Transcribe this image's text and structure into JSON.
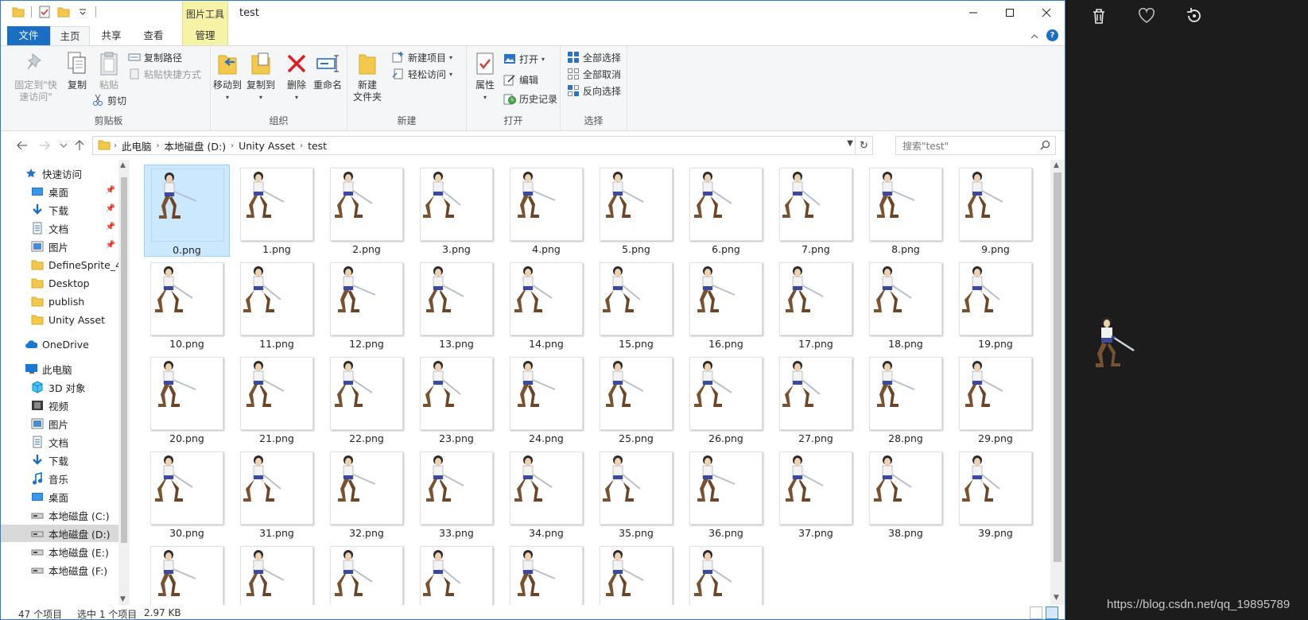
{
  "titlebar": {
    "contextual_tab": "图片工具",
    "title": "test"
  },
  "tabs": [
    {
      "label": "文件",
      "kind": "file"
    },
    {
      "label": "主页",
      "kind": "active"
    },
    {
      "label": "共享",
      "kind": "normal"
    },
    {
      "label": "查看",
      "kind": "normal"
    },
    {
      "label": "管理",
      "kind": "manage"
    }
  ],
  "ribbon": {
    "clipboard": {
      "label": "剪贴板",
      "pin_quick_access": "固定到\"快\n速访问\"",
      "copy": "复制",
      "paste": "粘贴",
      "copy_path": "复制路径",
      "paste_shortcut": "粘贴快捷方式",
      "cut": "剪切"
    },
    "organize": {
      "label": "组织",
      "move_to": "移动到",
      "copy_to": "复制到",
      "delete": "删除",
      "rename": "重命名"
    },
    "new": {
      "label": "新建",
      "new_folder": "新建\n文件夹",
      "new_item": "新建项目",
      "easy_access": "轻松访问"
    },
    "open": {
      "label": "打开",
      "properties": "属性",
      "open": "打开",
      "edit": "编辑",
      "history": "历史记录"
    },
    "select": {
      "label": "选择",
      "select_all": "全部选择",
      "select_none": "全部取消",
      "invert": "反向选择"
    }
  },
  "address": {
    "crumbs": [
      "此电脑",
      "本地磁盘 (D:)",
      "Unity Asset",
      "test"
    ],
    "search_placeholder": "搜索\"test\""
  },
  "nav": [
    {
      "label": "快速访问",
      "icon": "star-icon",
      "indent": 0
    },
    {
      "label": "桌面",
      "icon": "desktop-icon",
      "indent": 1,
      "pinned": true
    },
    {
      "label": "下载",
      "icon": "download-icon",
      "indent": 1,
      "pinned": true
    },
    {
      "label": "文档",
      "icon": "document-icon",
      "indent": 1,
      "pinned": true
    },
    {
      "label": "图片",
      "icon": "picture-icon",
      "indent": 1,
      "pinned": true
    },
    {
      "label": "DefineSprite_46",
      "icon": "folder-icon",
      "indent": 1
    },
    {
      "label": "Desktop",
      "icon": "folder-icon",
      "indent": 1
    },
    {
      "label": "publish",
      "icon": "folder-icon",
      "indent": 1
    },
    {
      "label": "Unity Asset",
      "icon": "folder-icon",
      "indent": 1
    },
    {
      "label": "OneDrive",
      "icon": "cloud-icon",
      "indent": 0,
      "gap": true
    },
    {
      "label": "此电脑",
      "icon": "pc-icon",
      "indent": 0,
      "gap": true
    },
    {
      "label": "3D 对象",
      "icon": "cube-icon",
      "indent": 1
    },
    {
      "label": "视频",
      "icon": "video-icon",
      "indent": 1
    },
    {
      "label": "图片",
      "icon": "picture-icon",
      "indent": 1
    },
    {
      "label": "文档",
      "icon": "document-icon",
      "indent": 1
    },
    {
      "label": "下载",
      "icon": "download-icon",
      "indent": 1
    },
    {
      "label": "音乐",
      "icon": "music-icon",
      "indent": 1
    },
    {
      "label": "桌面",
      "icon": "desktop-icon",
      "indent": 1
    },
    {
      "label": "本地磁盘 (C:)",
      "icon": "drive-icon",
      "indent": 1
    },
    {
      "label": "本地磁盘 (D:)",
      "icon": "drive-icon",
      "indent": 1,
      "selected": true
    },
    {
      "label": "本地磁盘 (E:)",
      "icon": "drive-icon",
      "indent": 1
    },
    {
      "label": "本地磁盘 (F:)",
      "icon": "drive-icon",
      "indent": 1
    }
  ],
  "files": {
    "count": 47,
    "selected_index": 0,
    "extension": ".png"
  },
  "status": {
    "items": "47 个项目",
    "selected": "选中 1 个项目",
    "size": "2.97 KB"
  },
  "viewer": {
    "watermark": "https://blog.csdn.net/qq_19895789"
  },
  "colors": {
    "accent": "#1a6fc2",
    "contextual": "#f6f3a6",
    "selection": "#cce8ff",
    "viewer_bg": "#1c1c1c"
  }
}
